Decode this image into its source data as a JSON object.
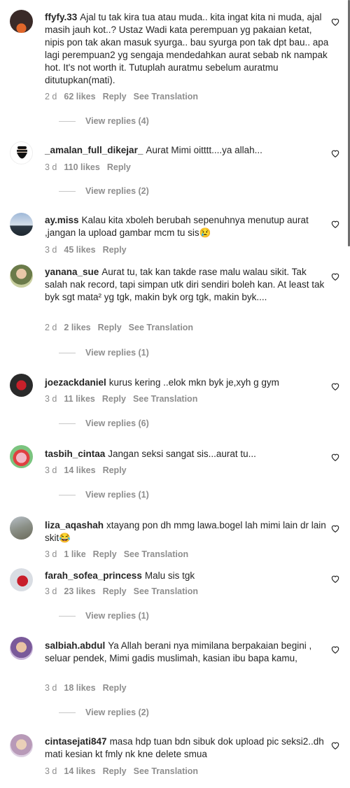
{
  "comments": [
    {
      "user": "ffyfy.33",
      "text": "Ajal tu tak kira tua atau muda.. kita ingat kita ni muda, ajal masih jauh kot..? Ustaz Wadi kata perempuan yg pakaian ketat, nipis pon tak akan masuk syurga.. bau syurga pon tak dpt bau.. apa lagi perempuan2 yg sengaja mendedahkan aurat sebab nk nampak hot. It's not worth it. Tutuplah auratmu sebelum auratmu ditutupkan(mati).",
      "time": "2 d",
      "likes": "62 likes",
      "reply": "Reply",
      "translate": "See Translation",
      "view_replies": "View replies (4)"
    },
    {
      "user": "_amalan_full_dikejar_",
      "text": "Aurat Mimi oitttt....ya allah...",
      "time": "3 d",
      "likes": "110 likes",
      "reply": "Reply",
      "translate": "",
      "view_replies": "View replies (2)"
    },
    {
      "user": "ay.miss",
      "text": "Kalau kita xboleh berubah sepenuhnya menutup aurat ,jangan la upload gambar mcm tu sis😢",
      "time": "3 d",
      "likes": "45 likes",
      "reply": "Reply",
      "translate": "",
      "view_replies": ""
    },
    {
      "user": "yanana_sue",
      "text": "Aurat tu, tak kan takde rase malu walau sikit. Tak salah nak record, tapi simpan utk diri sendiri boleh kan. At least tak byk sgt mata² yg tgk, makin byk org tgk, makin byk....",
      "time": "2 d",
      "likes": "2 likes",
      "reply": "Reply",
      "translate": "See Translation",
      "view_replies": "View replies (1)"
    },
    {
      "user": "joezackdaniel",
      "text": "kurus kering ..elok mkn byk je,xyh g gym",
      "time": "3 d",
      "likes": "11 likes",
      "reply": "Reply",
      "translate": "See Translation",
      "view_replies": "View replies (6)"
    },
    {
      "user": "tasbih_cintaa",
      "text": "Jangan seksi sangat sis...aurat tu...",
      "time": "3 d",
      "likes": "14 likes",
      "reply": "Reply",
      "translate": "",
      "view_replies": "View replies (1)"
    },
    {
      "user": "liza_aqashah",
      "text": "xtayang pon dh mmg lawa.bogel lah mimi lain dr lain skit😂",
      "time": "3 d",
      "likes": "1 like",
      "reply": "Reply",
      "translate": "See Translation",
      "view_replies": ""
    },
    {
      "user": "farah_sofea_princess",
      "text": "Malu sis tgk",
      "time": "3 d",
      "likes": "23 likes",
      "reply": "Reply",
      "translate": "See Translation",
      "view_replies": "View replies (1)"
    },
    {
      "user": "salbiah.abdul",
      "text": "Ya Allah berani nya mimilana berpakaian begini , seluar pendek, Mimi gadis muslimah, kasian ibu bapa kamu,",
      "time": "3 d",
      "likes": "18 likes",
      "reply": "Reply",
      "translate": "",
      "view_replies": "View replies (2)"
    },
    {
      "user": "cintasejati847",
      "text": "masa hdp tuan bdn sibuk dok upload pic seksi2..dh mati kesian kt fmly nk kne delete smua",
      "time": "3 d",
      "likes": "14 likes",
      "reply": "Reply",
      "translate": "See Translation",
      "view_replies": ""
    }
  ]
}
